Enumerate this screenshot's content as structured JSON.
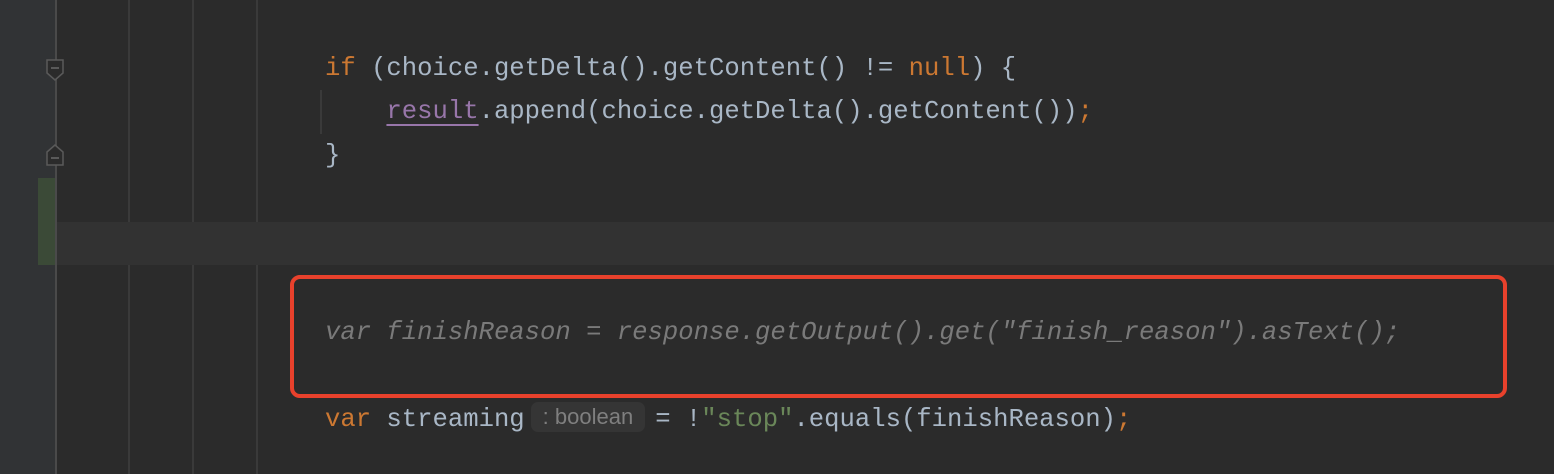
{
  "theme": {
    "background": "#2b2b2b",
    "keyword": "#cc7832",
    "string": "#6a8759",
    "field": "#9876aa",
    "text": "#a9b7c6",
    "highlight_box": "#e8412c"
  },
  "gutter": {
    "icons": [
      "fold-end-icon",
      "fold-start-icon"
    ],
    "change_marker": "added-lines"
  },
  "code": {
    "lines": [
      {
        "tokens": [
          {
            "t": "if",
            "c": "kw"
          },
          {
            "t": " (choice.getDelta().getContent() != ",
            "c": ""
          },
          {
            "t": "null",
            "c": "kw"
          },
          {
            "t": ") {",
            "c": ""
          }
        ]
      },
      {
        "tokens": [
          {
            "t": "    ",
            "c": ""
          },
          {
            "t": "result",
            "c": "field"
          },
          {
            "t": ".append(choice.getDelta().getContent())",
            "c": ""
          },
          {
            "t": ";",
            "c": "semi"
          }
        ]
      },
      {
        "tokens": [
          {
            "t": "}",
            "c": ""
          }
        ]
      },
      {
        "tokens": []
      },
      {
        "tokens": []
      },
      {
        "tokens": [
          {
            "t": "var finishReason = response.getOutput().get(\"finish_reason\").asText();",
            "c": "comment"
          }
        ]
      },
      {
        "tokens": []
      },
      {
        "tokens": [
          {
            "t": "var",
            "c": "kw"
          },
          {
            "t": " streaming",
            "c": ""
          },
          {
            "t": ": boolean",
            "c": "hint"
          },
          {
            "t": "= !",
            "c": ""
          },
          {
            "t": "\"stop\"",
            "c": "str"
          },
          {
            "t": ".equals(finishReason)",
            "c": ""
          },
          {
            "t": ";",
            "c": "semi"
          }
        ]
      }
    ]
  }
}
